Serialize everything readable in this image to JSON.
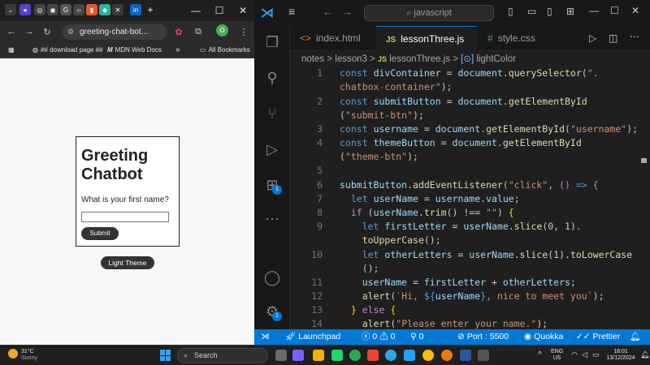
{
  "chrome": {
    "active_tab_title": "greeting-chat-bot...",
    "omnibox_text": "greeting-chat-bot...",
    "profile_letter": "O",
    "window_controls": [
      "minimize",
      "maximize",
      "close"
    ],
    "bookmarks": [
      {
        "label": "## download page ##",
        "icon": "globe-icon"
      },
      {
        "label": "MDN Web Docs",
        "icon": "mdn-icon"
      }
    ],
    "more_bookmarks": "»",
    "all_bookmarks": "All Bookmarks"
  },
  "page": {
    "title": "Greeting Chatbot",
    "question": "What is your first name?",
    "input_value": "",
    "submit_label": "Submit",
    "theme_label": "Light Theme"
  },
  "vscode": {
    "search_text": "javascript",
    "tabs": [
      {
        "icon_text": "<>",
        "label": "index.html",
        "color": "#e37933"
      },
      {
        "icon_text": "JS",
        "label": "lessonThree.js",
        "color": "#cbcb41"
      },
      {
        "icon_text": "#",
        "label": "style.css",
        "color": "#519aba"
      }
    ],
    "breadcrumb": {
      "parts": [
        "notes",
        "lesson3",
        "lessonThree.js",
        "lightColor"
      ],
      "sep": ">"
    },
    "line_numbers": [
      "1",
      "2",
      "3",
      "4",
      "5",
      "6",
      "7",
      "8",
      "9",
      "10",
      "11",
      "12",
      "13",
      "14"
    ],
    "activity_badges": {
      "extensions": "1",
      "manage": "1"
    },
    "status": {
      "launchpad": "Launchpad",
      "errors": "0",
      "warnings": "0",
      "ports": "0",
      "port_label": "Port : 5500",
      "quokka": "Quokka",
      "prettier": "Prettier"
    }
  },
  "taskbar": {
    "weather_temp": "31°C",
    "weather_text": "Sunny",
    "search_placeholder": "Search",
    "lang_top": "ENG",
    "lang_bottom": "US",
    "time": "18:01",
    "date": "13/12/2024"
  },
  "colors": {
    "vscode_accent": "#0078d4",
    "keyword": "#569cd6",
    "variable": "#9cdcfe",
    "function": "#dcdcaa",
    "string": "#ce9178"
  }
}
